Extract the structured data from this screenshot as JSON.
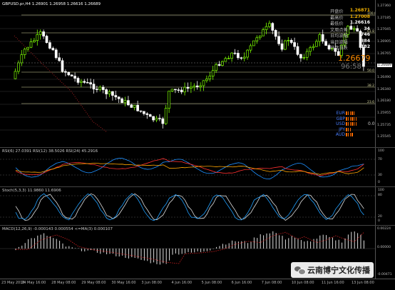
{
  "chart_title": "GBPUSD.pr,H4  1.26901 1.26958 1.26616 1.26689",
  "info_panel": [
    {
      "label": "开盘价",
      "value": "1.26871",
      "color": "#f0b000"
    },
    {
      "label": "最高价",
      "value": "1.27008",
      "color": "#f0b000"
    },
    {
      "label": "最低价",
      "value": "1.26616",
      "color": "#ffffff"
    },
    {
      "label": "文周点差",
      "value": "34",
      "color": "#ffffff"
    },
    {
      "label": "日均波幅",
      "value": "746",
      "color": "#ffffff"
    },
    {
      "label": "当日波幅",
      "value": "384",
      "color": "#ffffff"
    },
    {
      "label": "开盘涨跌",
      "value": "-182",
      "color": "#ffffff"
    }
  ],
  "big_price": "1.26679",
  "timer": "96:58",
  "fib_levels": [
    "100.0",
    "61.8",
    "50.0",
    "38.2",
    "23.6"
  ],
  "currency_strength": [
    {
      "code": "EUR",
      "bars": 5,
      "value": ""
    },
    {
      "code": "GBP",
      "bars": 6,
      "value": ""
    },
    {
      "code": "USD",
      "bars": 6,
      "value": "0.0"
    },
    {
      "code": "JPY",
      "bars": 3,
      "value": ""
    },
    {
      "code": "AUD",
      "bars": 4,
      "value": ""
    }
  ],
  "price_axis": [
    "1.27360",
    "1.27185",
    "1.27045",
    "1.26905",
    "1.26765",
    "1.26689",
    "1.26490",
    "1.26340",
    "1.26180",
    "1.25955",
    "1.25735",
    "1.25545"
  ],
  "rsi_title": "RSI(6) 27.0391  RSI(12) 38.5026  RSI(24) 45.2916",
  "rsi_axis": [
    "100",
    "70",
    "30",
    "0"
  ],
  "stoch_title": "Stoch(5,3,3) 11.9860 11.6906",
  "stoch_axis": [
    "100",
    "80",
    "20",
    "0"
  ],
  "macd_title": "MACD(12,26,9) -0.000143 0.000554  <=MA(3) 0.000107",
  "macd_axis": [
    "0.00224",
    "0.00000",
    "-0.00471"
  ],
  "dates": [
    "23 May 2019",
    "24 May 16:00",
    "28 May 08:00",
    "29 May 08:00",
    "30 May 16:00",
    "3 Jun 08:00",
    "4 Jun 16:00",
    "5 Jun 08:00",
    "6 Jun 16:00",
    "7 Jun 08:00",
    "10 Jun 08:00",
    "11 Jun 16:00",
    "13 Jun 08:00"
  ],
  "watermark": "云南博宁文化传播",
  "colors": {
    "bull": "#7cfc00",
    "bear": "#ffffff",
    "grid": "#2a2a2a",
    "rsi6": "#1e90ff",
    "rsi12": "#ff3030",
    "rsi24": "#ffa500"
  }
}
